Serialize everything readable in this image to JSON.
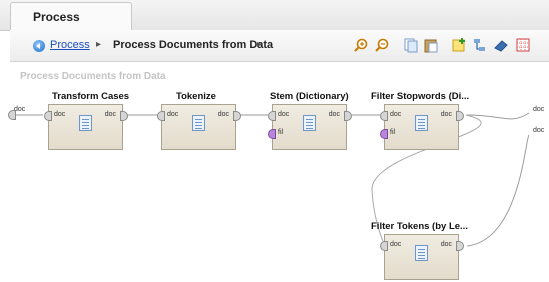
{
  "tabbar": {
    "tab_label": "Process"
  },
  "breadcrumb": {
    "root_link": "Process",
    "separator": "▸",
    "current": "Process Documents from Data"
  },
  "canvas": {
    "title": "Process Documents from Data",
    "outer_input": "doc",
    "outer_output_1": "doc",
    "outer_output_2": "doc"
  },
  "operators": [
    {
      "title": "Transform Cases",
      "in": "doc",
      "out": "doc"
    },
    {
      "title": "Tokenize",
      "in": "doc",
      "out": "doc"
    },
    {
      "title": "Stem (Dictionary)",
      "in": "doc",
      "out": "doc",
      "extra": "fil"
    },
    {
      "title": "Filter Stopwords (Di...",
      "in": "doc",
      "out": "doc",
      "extra": "fil"
    },
    {
      "title": "Filter Tokens (by Le...",
      "in": "doc",
      "out": "doc"
    }
  ],
  "toolbar_icons": [
    "zoom-in-icon",
    "zoom-out-icon",
    "copy-icon",
    "paste-icon",
    "add-note-icon",
    "arrange-icon",
    "eraser-icon",
    "grid-icon"
  ],
  "colors": {
    "link": "#1a4fbf",
    "operator_fill": "#e8e2d3",
    "wire": "#9a9a9a"
  }
}
